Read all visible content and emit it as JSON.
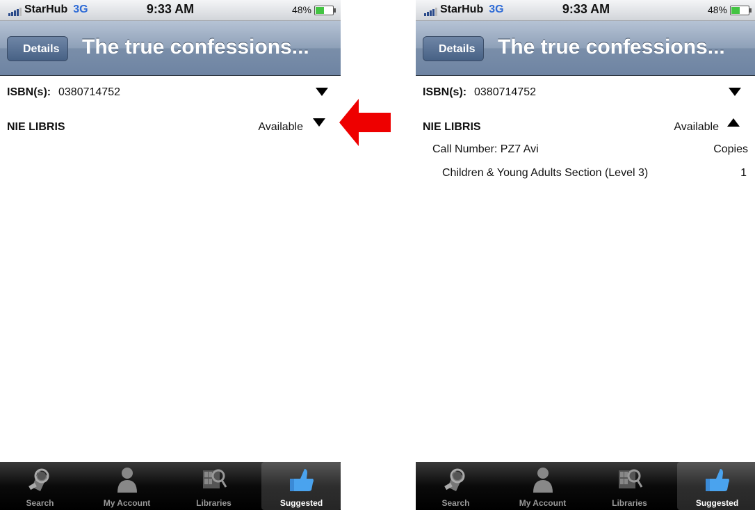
{
  "screens": [
    {
      "status": {
        "carrier": "StarHub",
        "network": "3G",
        "time": "9:33 AM",
        "battery": "48%"
      },
      "nav": {
        "back_label": "Details",
        "title": "The true confessions..."
      },
      "isbn": {
        "label": "ISBN(s):",
        "value": "0380714752"
      },
      "library": {
        "name": "NIE LIBRIS",
        "status": "Available",
        "expanded": false
      },
      "tabs": [
        {
          "label": "Search",
          "icon": "magnifier-book-icon",
          "active": false
        },
        {
          "label": "My Account",
          "icon": "person-icon",
          "active": false
        },
        {
          "label": "Libraries",
          "icon": "library-search-icon",
          "active": false
        },
        {
          "label": "Suggested",
          "icon": "thumbs-up-icon",
          "active": true
        }
      ]
    },
    {
      "status": {
        "carrier": "StarHub",
        "network": "3G",
        "time": "9:33 AM",
        "battery": "48%"
      },
      "nav": {
        "back_label": "Details",
        "title": "The true confessions..."
      },
      "isbn": {
        "label": "ISBN(s):",
        "value": "0380714752"
      },
      "library": {
        "name": "NIE LIBRIS",
        "status": "Available",
        "expanded": true
      },
      "holdings": {
        "call_number": "Call Number: PZ7 Avi",
        "copies_header": "Copies",
        "sections": [
          {
            "name": "Children & Young Adults Section (Level 3)",
            "copies": "1"
          }
        ]
      },
      "tabs": [
        {
          "label": "Search",
          "icon": "magnifier-book-icon",
          "active": false
        },
        {
          "label": "My Account",
          "icon": "person-icon",
          "active": false
        },
        {
          "label": "Libraries",
          "icon": "library-search-icon",
          "active": false
        },
        {
          "label": "Suggested",
          "icon": "thumbs-up-icon",
          "active": true
        }
      ]
    }
  ],
  "annotation": {
    "icon": "left-arrow-icon",
    "color": "#ee0000"
  }
}
